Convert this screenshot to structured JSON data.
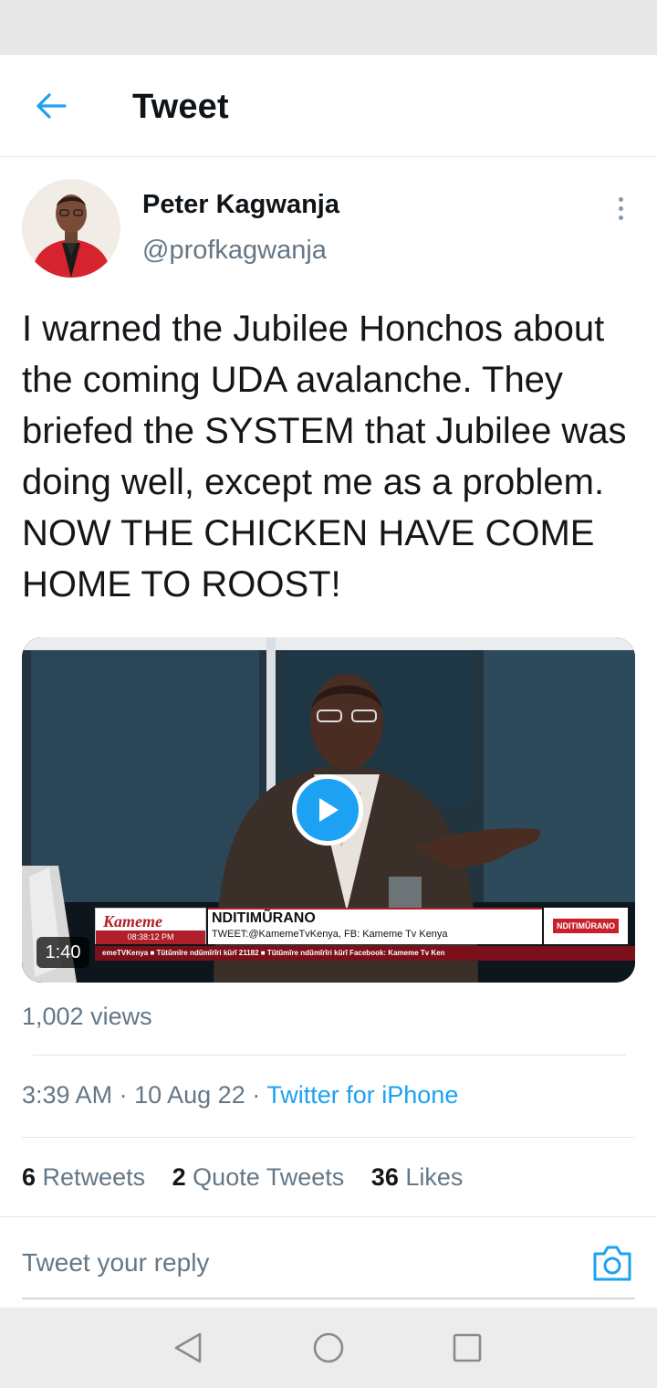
{
  "header": {
    "title": "Tweet"
  },
  "tweet": {
    "author_name": "Peter Kagwanja",
    "author_handle": "@profkagwanja",
    "text": "I warned the Jubilee Honchos about the coming UDA avalanche. They briefed the SYSTEM that Jubilee was doing well, except me as a problem. NOW THE CHICKEN HAVE COME HOME TO ROOST!",
    "video": {
      "duration": "1:40",
      "overlay_logo": "Kameme",
      "overlay_time": "08:38:12 PM",
      "overlay_title": "NDITIMŨRANO",
      "overlay_subtitle": "TWEET:@KamemeTvKenya, FB: Kameme Tv Kenya",
      "overlay_badge": "NDITIMŨRANO",
      "overlay_ticker": "emeTVKenya  ■ Tũtũmĩre ndũmĩrĩri kũrĩ 21182  ■ Tũtũmĩre ndũmĩrĩri kũrĩ Facebook: Kameme Tv Ken"
    },
    "views": "1,002 views",
    "time": "3:39 AM",
    "separator": "·",
    "date": "10 Aug 22",
    "source": "Twitter for iPhone",
    "stats": {
      "retweets_count": "6",
      "retweets_label": "Retweets",
      "quotes_count": "2",
      "quotes_label": "Quote Tweets",
      "likes_count": "36",
      "likes_label": "Likes"
    }
  },
  "reply": {
    "placeholder": "Tweet your reply"
  },
  "colors": {
    "accent": "#1da1f2",
    "secondary_text": "#657786",
    "divider": "#e1e8ed"
  },
  "icons": {
    "back": "arrow-left-icon",
    "more": "more-vertical-icon",
    "play": "play-icon",
    "camera": "camera-icon",
    "nav_back": "triangle-back-icon",
    "nav_home": "circle-home-icon",
    "nav_recents": "square-recents-icon"
  }
}
